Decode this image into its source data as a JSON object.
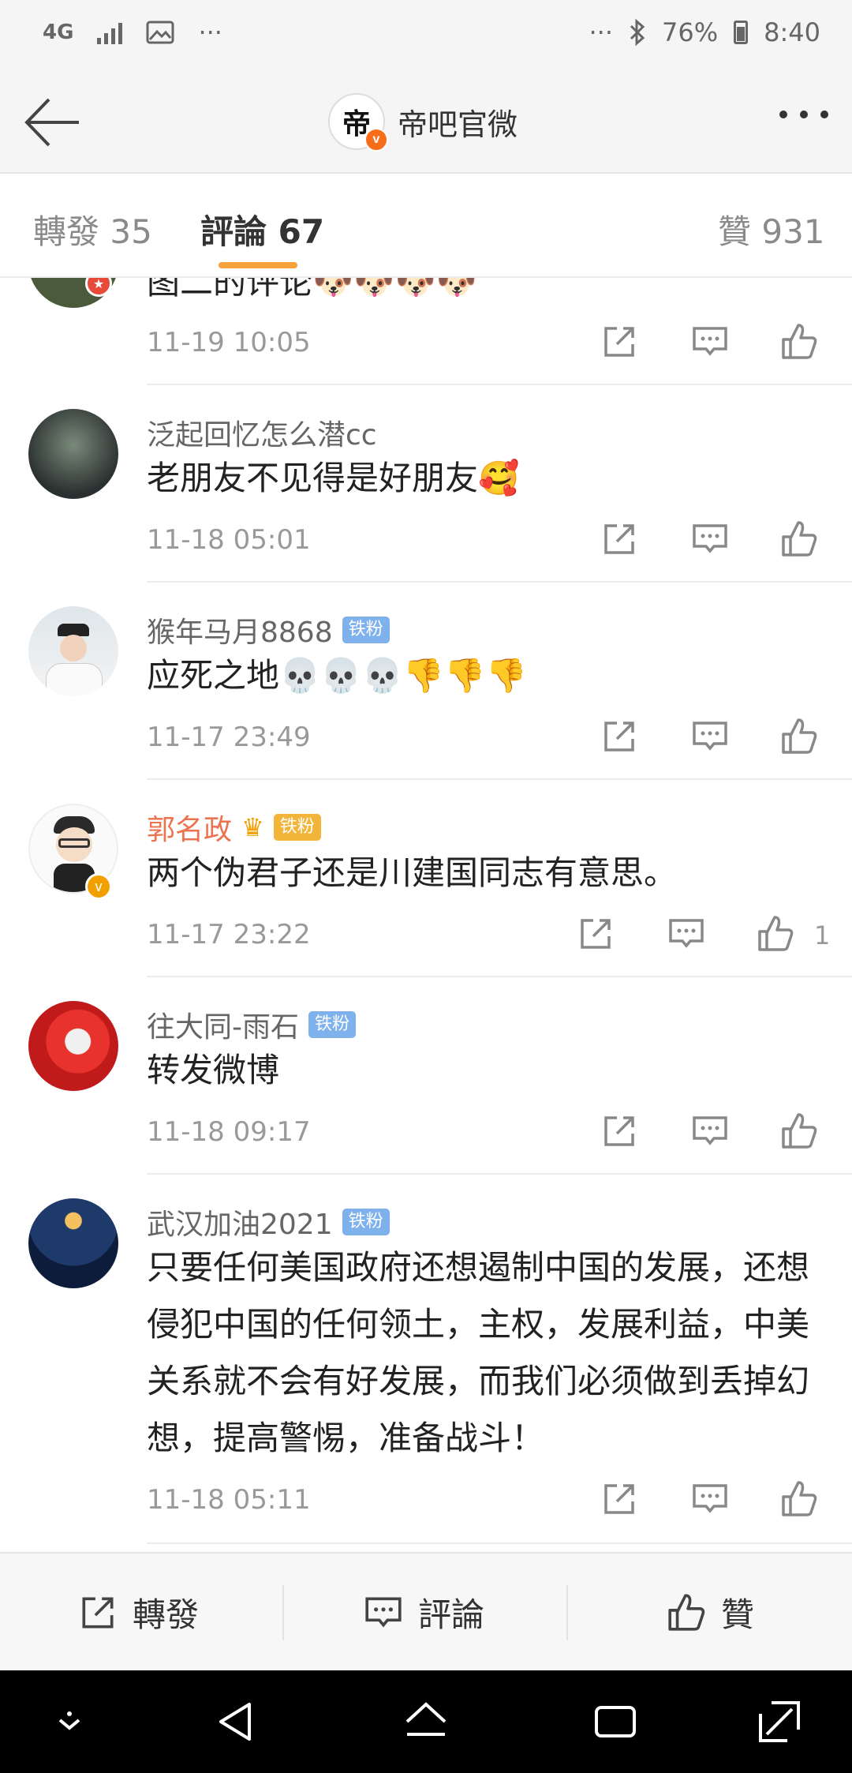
{
  "status_bar": {
    "network": "4G",
    "more_left": "···",
    "more_right": "···",
    "battery": "76%",
    "time": "8:40"
  },
  "header": {
    "title": "帝吧官微",
    "avatar_char": "帝"
  },
  "tabs": {
    "repost": "轉發 35",
    "comments": "評論 67",
    "likes": "贊 931"
  },
  "comments": [
    {
      "name": "",
      "content": "图二的评论🐶🐶🐶🐶",
      "time": "11-19 10:05",
      "likes": ""
    },
    {
      "name": "泛起回忆怎么潜cc",
      "content": "老朋友不见得是好朋友🥰",
      "time": "11-18 05:01",
      "likes": ""
    },
    {
      "name": "猴年马月8868",
      "badge": "铁粉",
      "content": "应死之地💀💀💀👎👎👎",
      "time": "11-17 23:49",
      "likes": ""
    },
    {
      "name": "郭名政",
      "badge": "铁粉",
      "content": "两个伪君子还是川建国同志有意思。",
      "time": "11-17 23:22",
      "likes": "1"
    },
    {
      "name": "往大同-雨石",
      "badge": "铁粉",
      "content": "转发微博",
      "time": "11-18 09:17",
      "likes": ""
    },
    {
      "name": "武汉加油2021",
      "badge": "铁粉",
      "content": "只要任何美国政府还想遏制中国的发展，还想侵犯中国的任何领土，主权，发展利益，中美关系就不会有好发展，而我们必须做到丢掉幻想，提高警惕，准备战斗！",
      "time": "11-18 05:11",
      "likes": ""
    }
  ],
  "bottom_bar": {
    "repost": "轉發",
    "comment": "評論",
    "like": "贊"
  },
  "colors": {
    "accent": "#f7a13a",
    "vip_name": "#eb7350",
    "fan_badge": "#7fb1ec"
  }
}
